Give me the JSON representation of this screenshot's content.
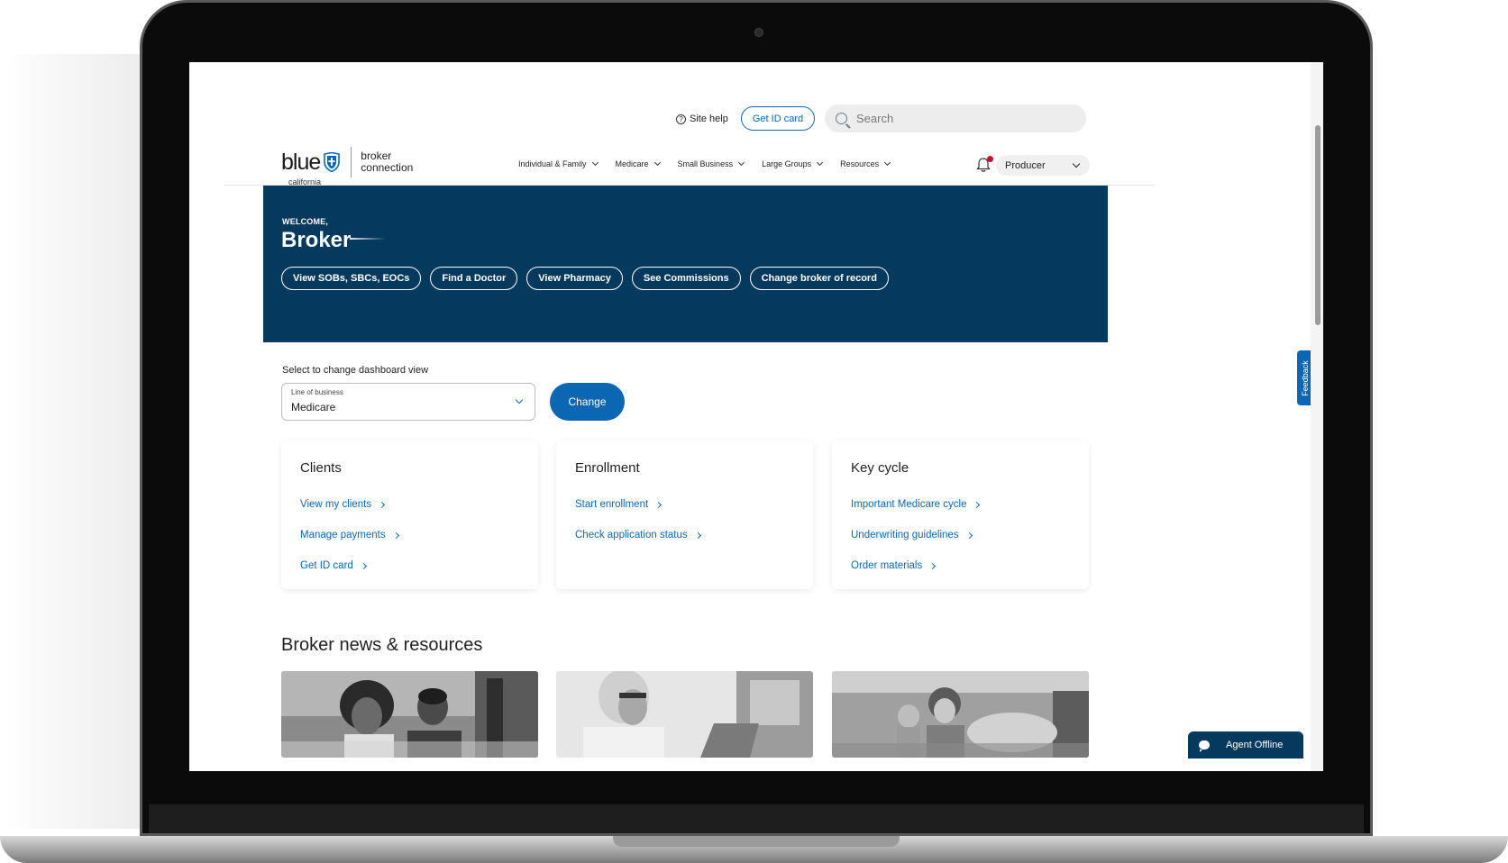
{
  "utility": {
    "site_help": "Site help",
    "get_id_card": "Get ID card",
    "search_placeholder": "Search"
  },
  "brand": {
    "logo_word": "blue",
    "logo_region": "california",
    "logo_line1": "broker",
    "logo_line2": "connection"
  },
  "nav": {
    "items": [
      {
        "label": "Individual & Family"
      },
      {
        "label": "Medicare"
      },
      {
        "label": "Small Business"
      },
      {
        "label": "Large Groups"
      },
      {
        "label": "Resources"
      }
    ]
  },
  "account": {
    "role_selected": "Producer",
    "has_notification": true
  },
  "hero": {
    "welcome": "WELCOME,",
    "name": "Broker",
    "quick_links": [
      "View SOBs, SBCs, EOCs",
      "Find a Doctor",
      "View Pharmacy",
      "See Commissions",
      "Change broker of record"
    ]
  },
  "dashboard": {
    "label": "Select to change dashboard view",
    "select_label": "Line of business",
    "select_value": "Medicare",
    "change_button": "Change"
  },
  "cards": [
    {
      "title": "Clients",
      "links": [
        "View my clients",
        "Manage payments",
        "Get ID card"
      ]
    },
    {
      "title": "Enrollment",
      "links": [
        "Start enrollment",
        "Check application status"
      ]
    },
    {
      "title": "Key cycle",
      "links": [
        "Important Medicare cycle",
        "Underwriting guidelines",
        "Order materials"
      ]
    }
  ],
  "news": {
    "title": "Broker news & resources"
  },
  "chat": {
    "label": "Agent Offline"
  },
  "feedback": {
    "label": "Feedback"
  },
  "colors": {
    "brand_navy": "#05395e",
    "link_blue": "#0b67b3",
    "alert_red": "#c8102e"
  }
}
